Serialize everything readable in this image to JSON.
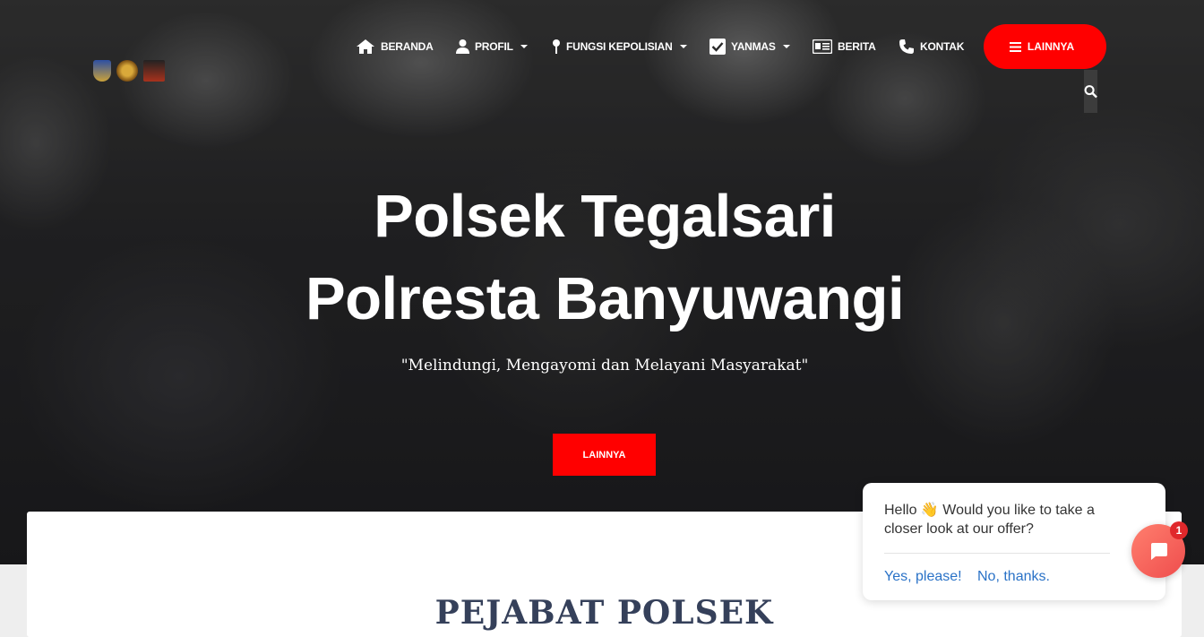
{
  "nav": {
    "items": [
      {
        "label": "BERANDA",
        "icon": "home-icon"
      },
      {
        "label": "PROFIL",
        "icon": "user-icon"
      },
      {
        "label": "FUNGSI KEPOLISIAN",
        "icon": "map-pin-icon"
      },
      {
        "label": "YANMAS",
        "icon": "checkbox-icon"
      },
      {
        "label": "BERITA",
        "icon": "newspaper-icon"
      },
      {
        "label": "KONTAK",
        "icon": "phone-icon"
      }
    ],
    "more_label": "LAINNYA",
    "search_icon": "search-icon"
  },
  "hero": {
    "title_line1": "Polsek Tegalsari",
    "title_line2": "Polresta Banyuwangi",
    "subtitle": "\"Melindungi, Mengayomi dan Melayani Masyarakat\"",
    "button_label": "LAINNYA"
  },
  "section": {
    "title": "PEJABAT POLSEK"
  },
  "chat": {
    "message_prefix": "Hello",
    "wave_emoji": "👋",
    "message_rest": "Would you like to take a closer look at our offer?",
    "yes_label": "Yes, please!",
    "no_label": "No, thanks.",
    "badge_count": "1"
  },
  "colors": {
    "accent": "#ff0000",
    "chat_link": "#2a72c7",
    "section_title": "#35405a"
  }
}
